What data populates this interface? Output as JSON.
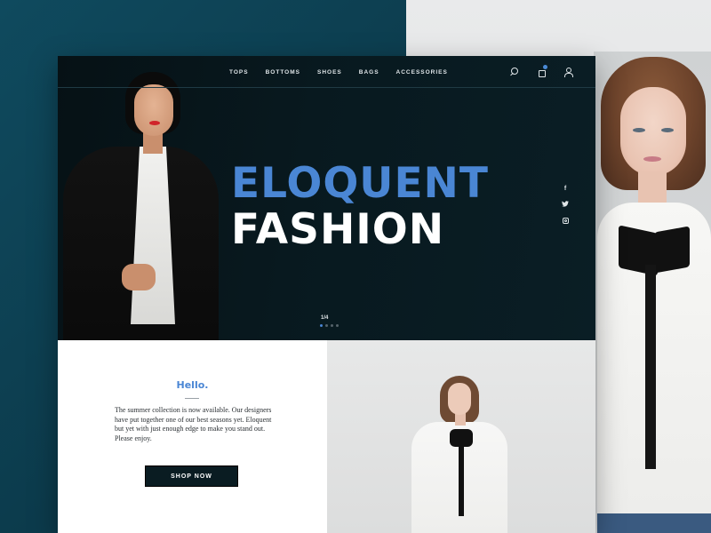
{
  "nav": {
    "items": [
      "TOPS",
      "BOTTOMS",
      "SHOES",
      "BAGS",
      "ACCESSORIES"
    ]
  },
  "hero": {
    "title_line1": "ELOQUENT",
    "title_line2": "FASHION",
    "slide_counter": "1/4",
    "social": [
      "f",
      "𝕋"
    ]
  },
  "intro": {
    "heading": "Hello.",
    "body": "The summer collection is now available. Our designers have put together one of our best seasons yet.  Eloquent but yet with just enough edge to make you stand out.  Please enjoy.",
    "cta_label": "SHOP NOW"
  },
  "colors": {
    "accent": "#4a86d4",
    "hero_bg": "#08191f",
    "button_bg": "#0a1c22"
  },
  "icons": [
    "search-icon",
    "shopping-bag-icon",
    "user-icon",
    "facebook-icon",
    "twitter-icon",
    "instagram-icon"
  ]
}
